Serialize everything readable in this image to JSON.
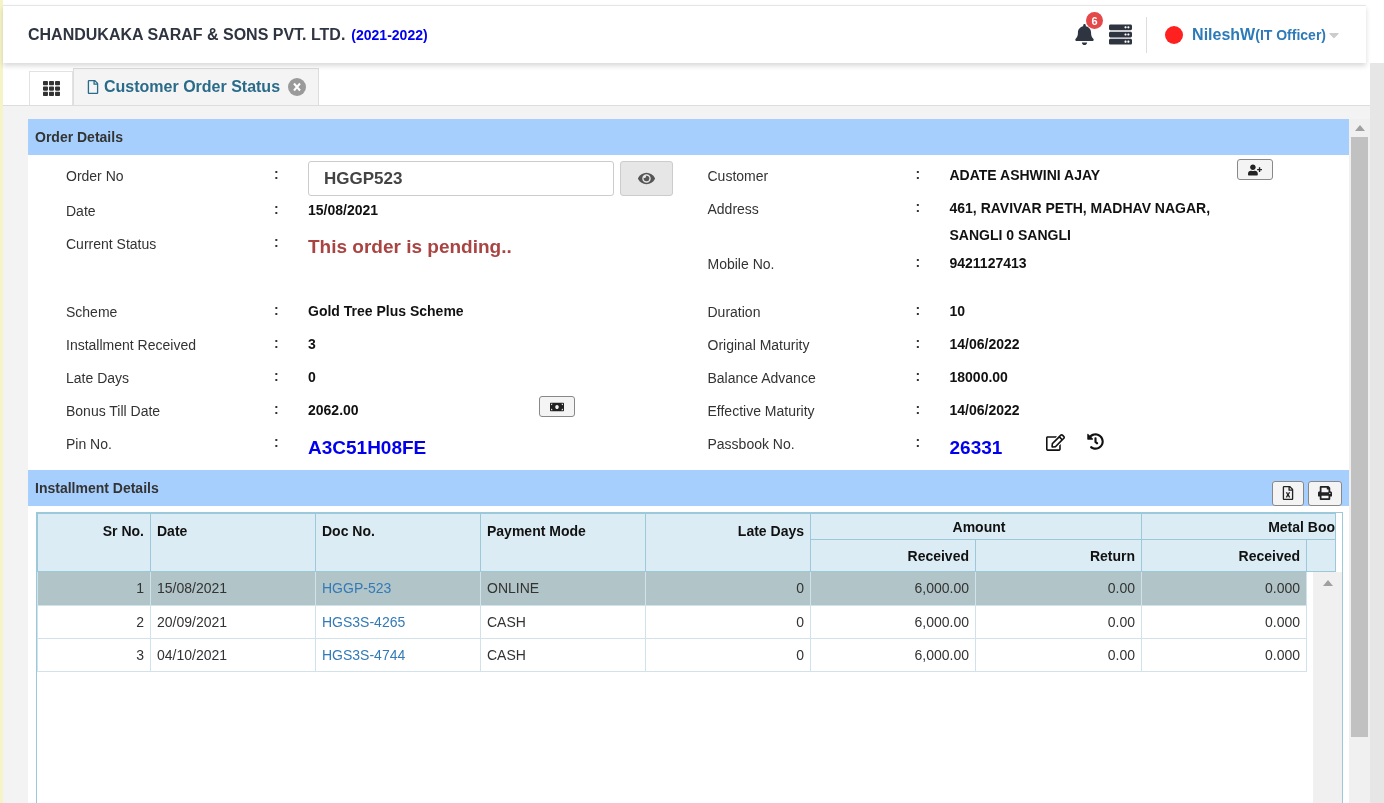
{
  "header": {
    "company": "CHANDUKAKA SARAF & SONS PVT. LTD.",
    "year": "(2021-2022)",
    "notification_count": "6",
    "user": {
      "name": "NileshW",
      "role": "(IT Officer)"
    }
  },
  "tabs": [
    {
      "label": "Customer Order Status",
      "selected": true
    }
  ],
  "order_details": {
    "title": "Order Details",
    "separator": ":",
    "left_groups": [
      [
        {
          "label": "Order No",
          "kind": "input",
          "value": "HGGP523"
        },
        {
          "label": "Date",
          "kind": "text",
          "value": "15/08/2021"
        },
        {
          "label": "Current Status",
          "kind": "status",
          "value": "This order is pending.."
        }
      ],
      [
        {
          "label": "Scheme",
          "kind": "text",
          "value": "Gold Tree Plus Scheme"
        },
        {
          "label": "Installment Received",
          "kind": "text",
          "value": "3"
        },
        {
          "label": "Late Days",
          "kind": "text",
          "value": "0"
        },
        {
          "label": "Bonus Till Date",
          "kind": "text",
          "value": "2062.00"
        },
        {
          "label": "Pin No.",
          "kind": "code",
          "value": "A3C51H08FE"
        }
      ]
    ],
    "right_groups": [
      [
        {
          "label": "Customer",
          "kind": "text",
          "value": "ADATE ASHWINI AJAY"
        },
        {
          "label": "Address",
          "kind": "text",
          "value": "461, RAVIVAR PETH, MADHAV NAGAR, SANGLI 0 SANGLI"
        },
        {
          "label": "Mobile No.",
          "kind": "text",
          "value": "9421127413"
        }
      ],
      [
        {
          "label": "Duration",
          "kind": "text",
          "value": "10"
        },
        {
          "label": "Original Maturity",
          "kind": "text",
          "value": "14/06/2022"
        },
        {
          "label": "Balance Advance",
          "kind": "text",
          "value": "18000.00"
        },
        {
          "label": "Effective Maturity",
          "kind": "text",
          "value": "14/06/2022"
        },
        {
          "label": "Passbook No.",
          "kind": "code",
          "value": "26331"
        }
      ]
    ]
  },
  "installment_details": {
    "title": "Installment Details",
    "columns": [
      "Sr No.",
      "Date",
      "Doc No.",
      "Payment Mode",
      "Late Days"
    ],
    "groups": [
      {
        "label": "Amount",
        "columns": [
          "Received",
          "Return"
        ]
      },
      {
        "label": "Metal Boo",
        "columns": [
          "Received"
        ]
      }
    ],
    "rows": [
      {
        "selected": true,
        "cells": [
          "1",
          "15/08/2021",
          "HGGP-523",
          "ONLINE",
          "0",
          "6,000.00",
          "0.00",
          "0.000"
        ]
      },
      {
        "selected": false,
        "cells": [
          "2",
          "20/09/2021",
          "HGS3S-4265",
          "CASH",
          "0",
          "6,000.00",
          "0.00",
          "0.000"
        ]
      },
      {
        "selected": false,
        "cells": [
          "3",
          "04/10/2021",
          "HGS3S-4744",
          "CASH",
          "0",
          "6,000.00",
          "0.00",
          "0.000"
        ]
      }
    ]
  }
}
